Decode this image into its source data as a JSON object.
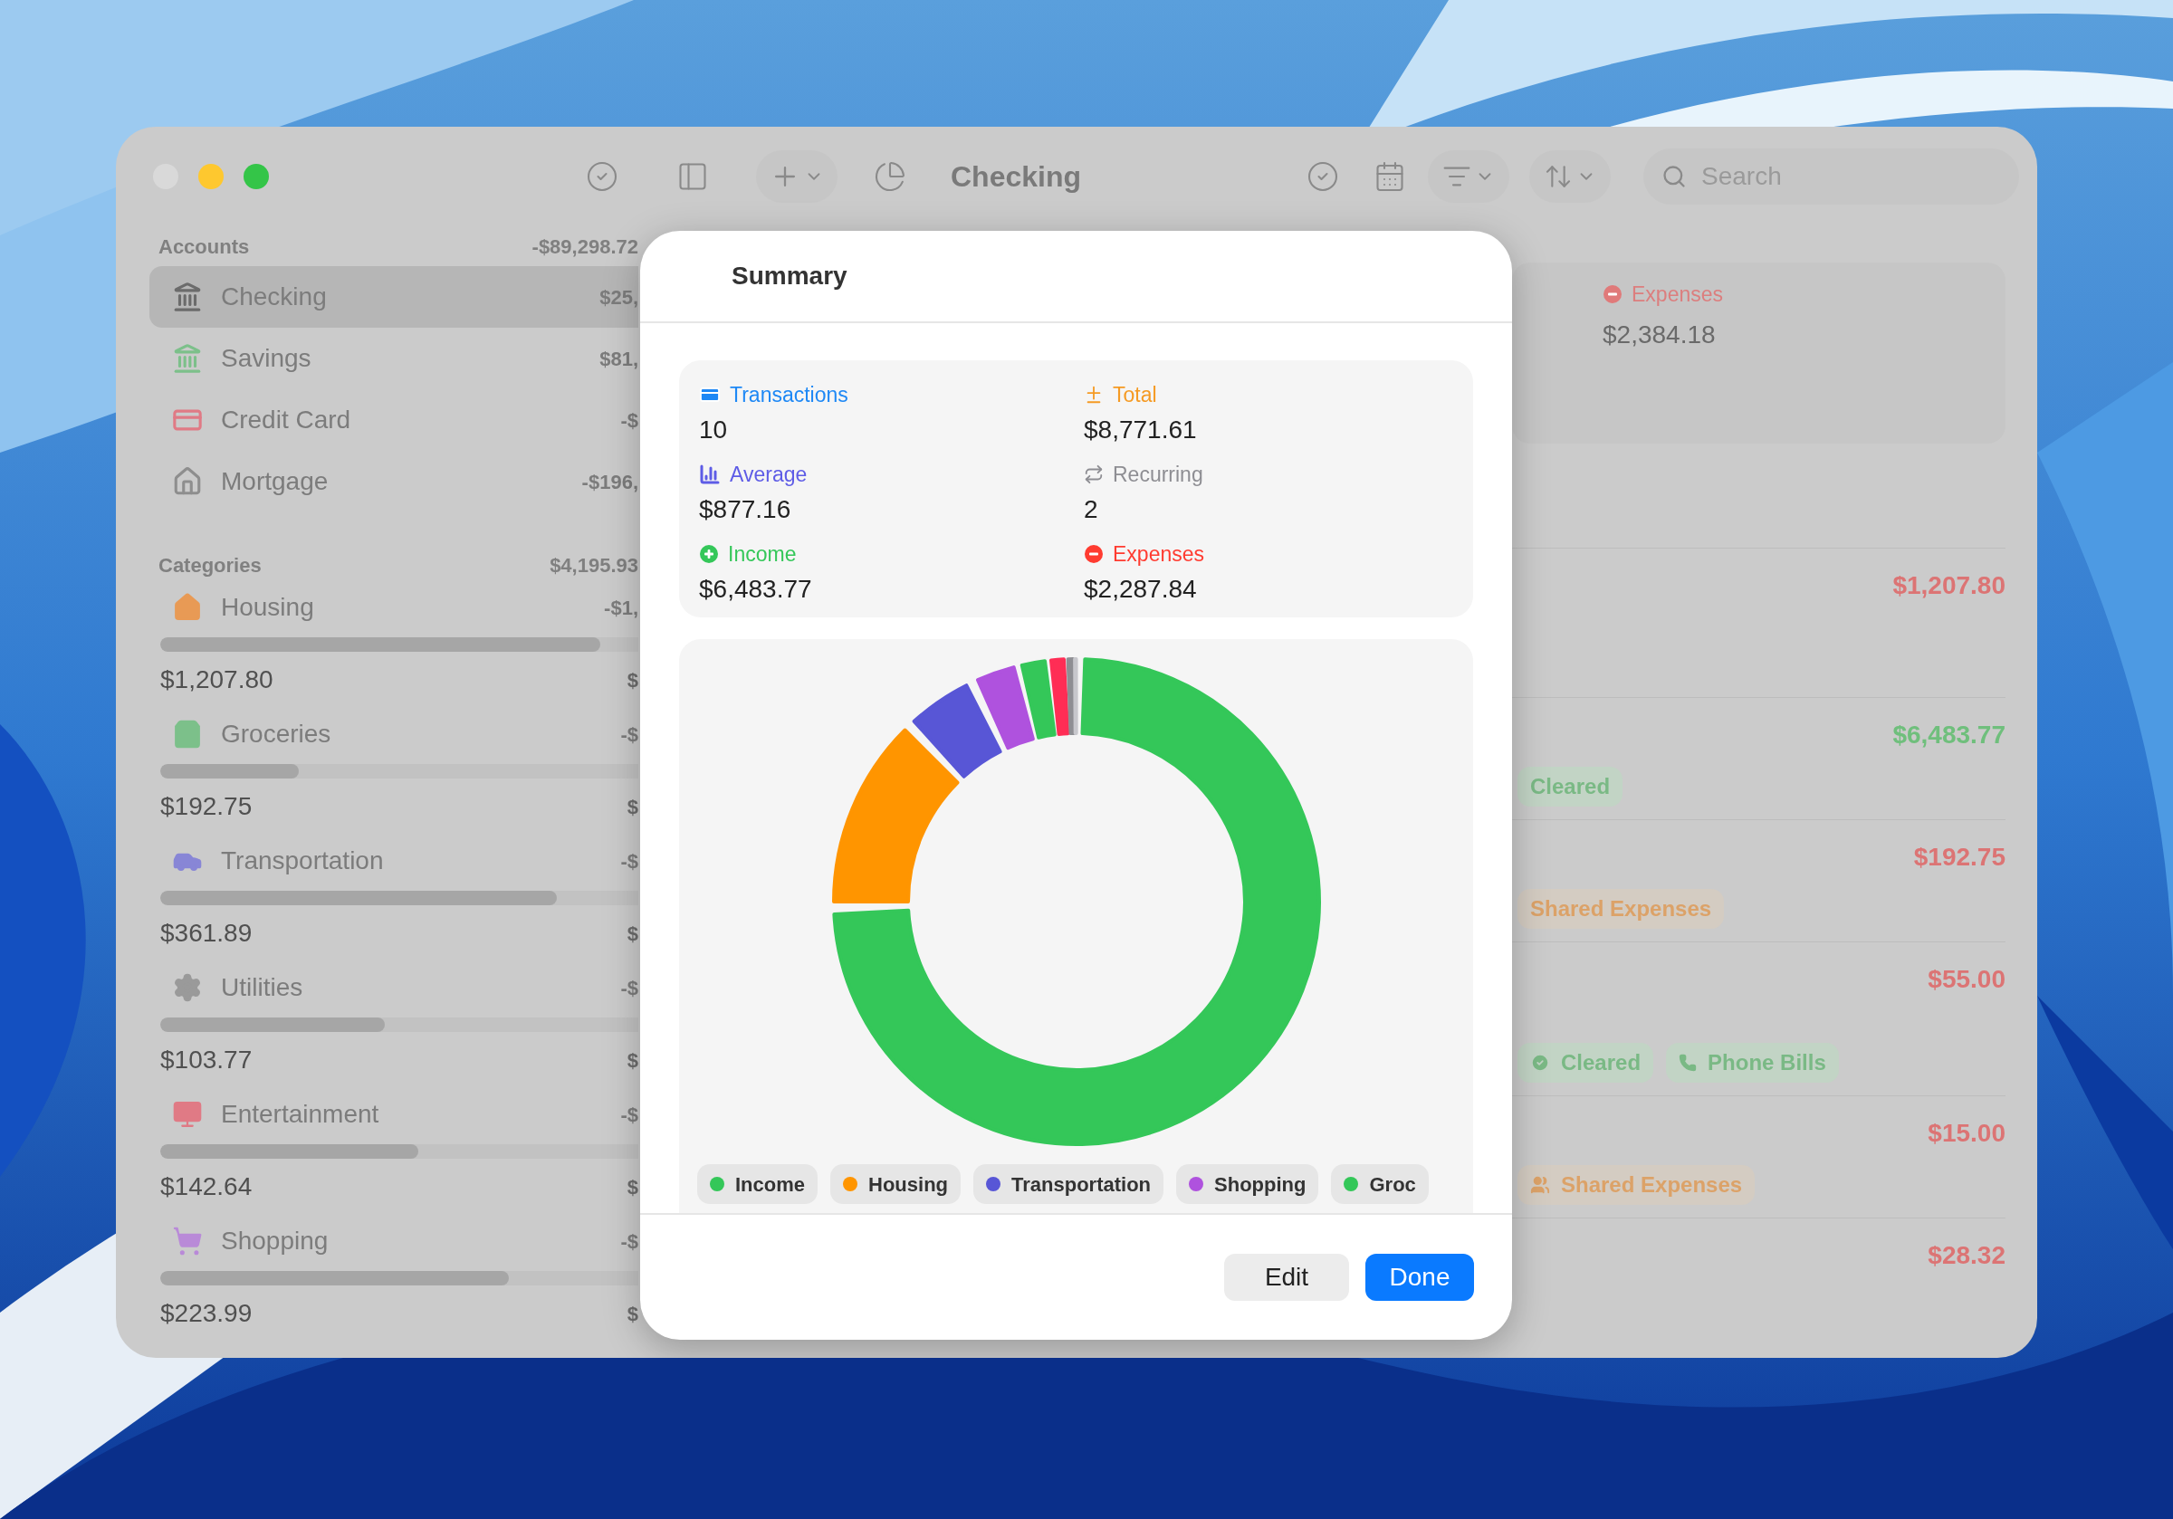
{
  "window": {
    "title": "Checking",
    "search": {
      "placeholder": "Search"
    }
  },
  "sidebar": {
    "accounts": {
      "header": "Accounts",
      "total": "-$89,298.72",
      "items": [
        {
          "name": "Checking",
          "amount": "$25,",
          "selected": true,
          "color": "#6b6b6b"
        },
        {
          "name": "Savings",
          "amount": "$81,",
          "selected": false,
          "color": "#7cc08a"
        },
        {
          "name": "Credit Card",
          "amount": "-$",
          "selected": false,
          "color": "#e07a85"
        },
        {
          "name": "Mortgage",
          "amount": "-$196,",
          "selected": false,
          "color": "#8e8e8e"
        }
      ]
    },
    "categories": {
      "header": "Categories",
      "total": "$4,195.93",
      "items": [
        {
          "name": "Housing",
          "amount": "-$1,",
          "spent": "$1,207.80",
          "budget": "$",
          "level": 0.92,
          "color": "#e89a55"
        },
        {
          "name": "Groceries",
          "amount": "-$",
          "spent": "$192.75",
          "budget": "$",
          "level": 0.29,
          "color": "#7cc08a"
        },
        {
          "name": "Transportation",
          "amount": "-$",
          "spent": "$361.89",
          "budget": "$",
          "level": 0.83,
          "color": "#8886d6"
        },
        {
          "name": "Utilities",
          "amount": "-$",
          "spent": "$103.77",
          "budget": "$",
          "level": 0.47,
          "color": "#9a9a9a"
        },
        {
          "name": "Entertainment",
          "amount": "-$",
          "spent": "$142.64",
          "budget": "$",
          "level": 0.54,
          "color": "#e07a85"
        },
        {
          "name": "Shopping",
          "amount": "-$",
          "spent": "$223.99",
          "budget": "$",
          "level": 0.73,
          "color": "#b98ad8"
        }
      ]
    }
  },
  "main": {
    "summary": {
      "label": "Expenses",
      "value": "$2,384.18"
    },
    "rows": [
      {
        "amount": "$1,207.80",
        "kind": "expense",
        "tags": []
      },
      {
        "amount": "$6,483.77",
        "kind": "income",
        "tags": [
          {
            "label": "Cleared",
            "kind": "cleared",
            "icon": false
          }
        ]
      },
      {
        "amount": "$192.75",
        "kind": "expense",
        "tags": [
          {
            "label": "Shared Expenses",
            "kind": "shared",
            "icon": false
          }
        ]
      },
      {
        "amount": "$55.00",
        "kind": "expense",
        "tags": [
          {
            "label": "Cleared",
            "kind": "cleared",
            "icon": true
          },
          {
            "label": "Phone Bills",
            "kind": "bill",
            "icon": true
          }
        ]
      },
      {
        "amount": "$15.00",
        "kind": "expense",
        "tags": [
          {
            "label": "Shared Expenses",
            "kind": "shared",
            "icon": true
          }
        ]
      },
      {
        "amount": "$28.32",
        "kind": "expense",
        "tags": []
      }
    ]
  },
  "modal": {
    "title": "Summary",
    "stats": [
      {
        "label": "Transactions",
        "value": "10",
        "color": "#1e88f5"
      },
      {
        "label": "Total",
        "value": "$8,771.61",
        "color": "#f59a23"
      },
      {
        "label": "Average",
        "value": "$877.16",
        "color": "#5e5ce6"
      },
      {
        "label": "Recurring",
        "value": "2",
        "color": "#8e8e93"
      },
      {
        "label": "Income",
        "value": "$6,483.77",
        "color": "#34c759"
      },
      {
        "label": "Expenses",
        "value": "$2,287.84",
        "color": "#ff3b30"
      }
    ],
    "legend": [
      {
        "label": "Income",
        "color": "#34c759"
      },
      {
        "label": "Housing",
        "color": "#ff9500"
      },
      {
        "label": "Transportation",
        "color": "#5856d6"
      },
      {
        "label": "Shopping",
        "color": "#af52de"
      },
      {
        "label": "Groc",
        "color": "#34c759"
      }
    ],
    "buttons": [
      {
        "label": "Edit",
        "kind": "secondary"
      },
      {
        "label": "Done",
        "kind": "primary"
      }
    ]
  }
}
